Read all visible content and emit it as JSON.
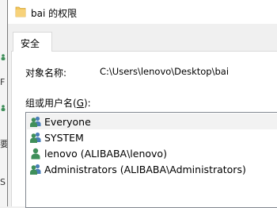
{
  "background_window": {
    "fragments": [
      "F",
      "要",
      "S"
    ]
  },
  "titlebar": {
    "title": "bai 的权限",
    "icon": "folder-icon"
  },
  "tabs": [
    {
      "label": "安全",
      "active": true
    }
  ],
  "security": {
    "object_name_label": "对象名称:",
    "object_name_value": "C:\\Users\\lenovo\\Desktop\\bai",
    "group_label_prefix": "组或用户名(",
    "group_label_accel": "G",
    "group_label_suffix": "):",
    "principals": [
      {
        "name": "Everyone",
        "icon": "users-group-icon",
        "selected": true
      },
      {
        "name": "SYSTEM",
        "icon": "users-group-icon",
        "selected": false
      },
      {
        "name": "lenovo (ALIBABA\\lenovo)",
        "icon": "user-icon",
        "selected": false
      },
      {
        "name": "Administrators (ALIBABA\\Administrators)",
        "icon": "users-group-icon",
        "selected": false
      }
    ]
  },
  "colors": {
    "folder": "#f2c55c",
    "user_icon": "#3f8f5a",
    "group_icon_back": "#4a7fb8"
  }
}
